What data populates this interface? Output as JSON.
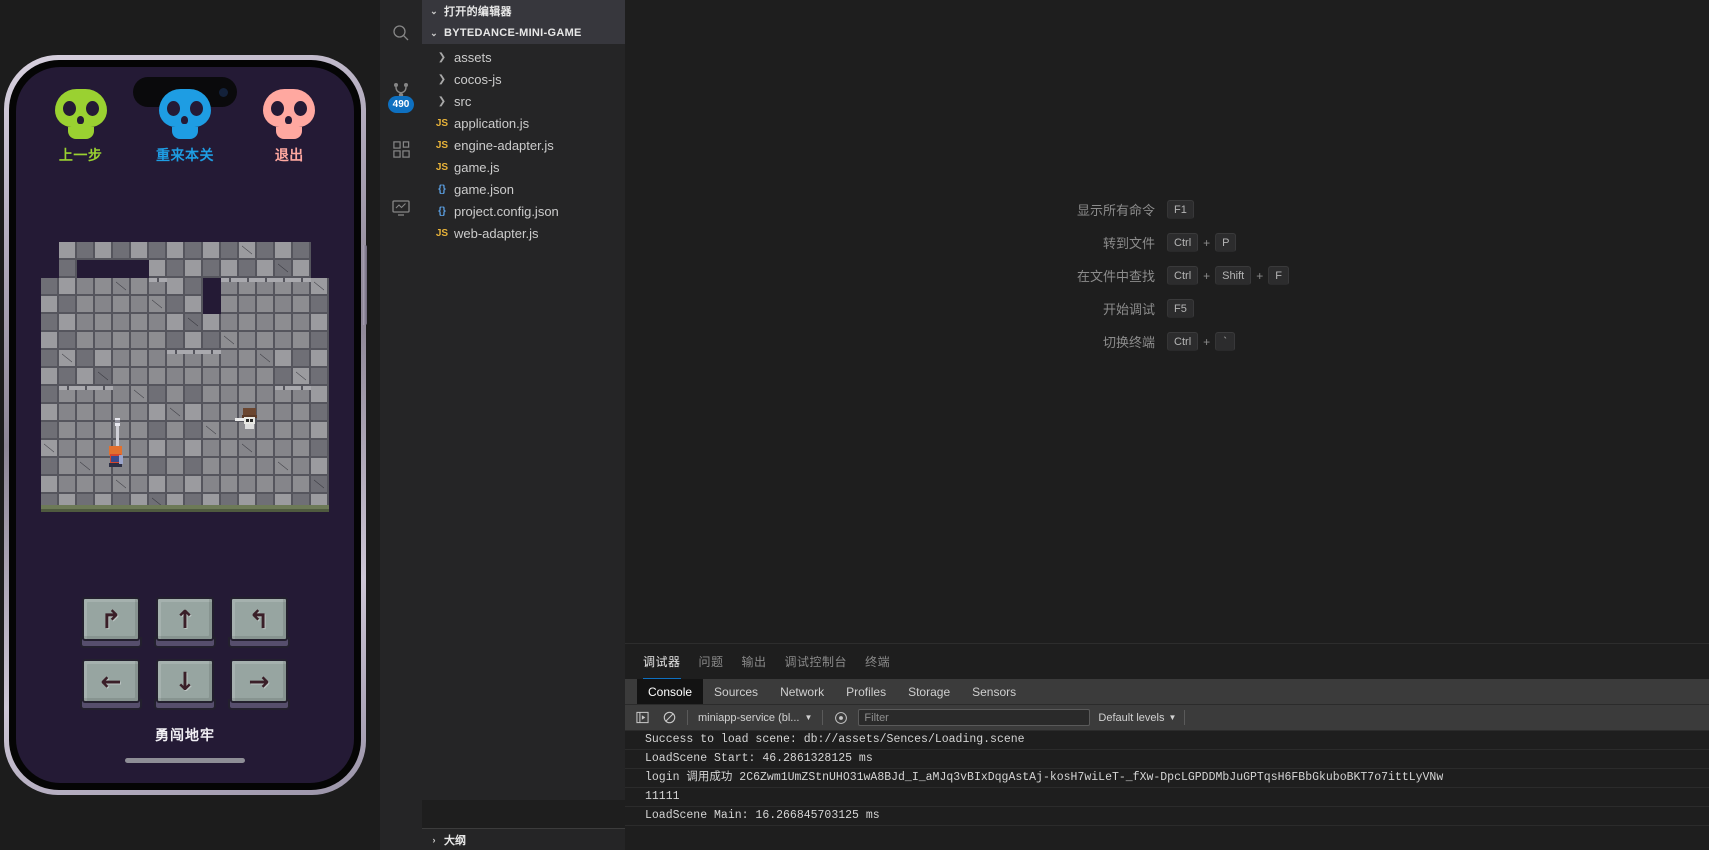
{
  "simulator": {
    "game_title": "勇闯地牢",
    "top_buttons": [
      {
        "label": "上一步",
        "color": "#9ad131",
        "icon": "skull-icon"
      },
      {
        "label": "重来本关",
        "color": "#1e9de3",
        "icon": "skull-icon"
      },
      {
        "label": "退出",
        "color": "#ffa8a0",
        "icon": "skull-icon"
      }
    ],
    "dpad_keys": [
      {
        "name": "rotate-left-key",
        "glyph": "↱"
      },
      {
        "name": "up-key",
        "glyph": "↑"
      },
      {
        "name": "rotate-right-key",
        "glyph": "↰"
      },
      {
        "name": "left-key",
        "glyph": "←"
      },
      {
        "name": "down-key",
        "glyph": "↓"
      },
      {
        "name": "right-key",
        "glyph": "→"
      }
    ],
    "screen_bg": "#241a35"
  },
  "activity_bar": {
    "items": [
      {
        "name": "search-icon",
        "badge": ""
      },
      {
        "name": "source-control-icon",
        "badge": "490"
      },
      {
        "name": "extensions-icon",
        "badge": ""
      },
      {
        "name": "remote-explorer-icon",
        "badge": ""
      }
    ],
    "badge_color": "#0e70c0"
  },
  "sidebar": {
    "open_editors_label": "打开的编辑器",
    "project_label": "BYTEDANCE-MINI-GAME",
    "outline_label": "大纲",
    "tree": [
      {
        "label": "assets",
        "type": "folder",
        "icon": "chevron-right-icon"
      },
      {
        "label": "cocos-js",
        "type": "folder",
        "icon": "chevron-right-icon"
      },
      {
        "label": "src",
        "type": "folder",
        "icon": "chevron-right-icon"
      },
      {
        "label": "application.js",
        "type": "js",
        "icon": "js-icon"
      },
      {
        "label": "engine-adapter.js",
        "type": "js",
        "icon": "js-icon"
      },
      {
        "label": "game.js",
        "type": "js",
        "icon": "js-icon"
      },
      {
        "label": "game.json",
        "type": "json",
        "icon": "json-icon"
      },
      {
        "label": "project.config.json",
        "type": "json",
        "icon": "json-icon"
      },
      {
        "label": "web-adapter.js",
        "type": "js",
        "icon": "js-icon"
      }
    ]
  },
  "editor": {
    "shortcuts": [
      {
        "label": "显示所有命令",
        "keys": [
          "F1"
        ]
      },
      {
        "label": "转到文件",
        "keys": [
          "Ctrl",
          "+",
          "P"
        ]
      },
      {
        "label": "在文件中查找",
        "keys": [
          "Ctrl",
          "+",
          "Shift",
          "+",
          "F"
        ]
      },
      {
        "label": "开始调试",
        "keys": [
          "F5"
        ]
      },
      {
        "label": "切换终端",
        "keys": [
          "Ctrl",
          "+",
          "`"
        ]
      }
    ]
  },
  "panel": {
    "tabs": [
      {
        "label": "调试器",
        "active": true
      },
      {
        "label": "问题",
        "active": false
      },
      {
        "label": "输出",
        "active": false
      },
      {
        "label": "调试控制台",
        "active": false
      },
      {
        "label": "终端",
        "active": false
      }
    ],
    "devtools_tabs": [
      {
        "label": "Console",
        "active": true
      },
      {
        "label": "Sources",
        "active": false
      },
      {
        "label": "Network",
        "active": false
      },
      {
        "label": "Profiles",
        "active": false
      },
      {
        "label": "Storage",
        "active": false
      },
      {
        "label": "Sensors",
        "active": false
      }
    ],
    "toolbar": {
      "execute_icon": "execute-snippet-icon",
      "clear_icon": "clear-console-icon",
      "context_value": "miniapp-service (bl...",
      "context_caret": "▼",
      "eye_icon": "live-expression-icon",
      "filter_placeholder": "Filter",
      "levels_label": "Default levels",
      "levels_caret": "▼"
    },
    "logs": [
      "Success to load scene: db://assets/Sences/Loading.scene",
      "LoadScene Start: 46.2861328125 ms",
      "login 调用成功 2C6Zwm1UmZStnUHO31wA8BJd_I_aMJq3vBIxDqgAstAj-kosH7wiLeT-_fXw-DpcLGPDDMbJuGPTqsH6FBbGkuboBKT7o7ittLyVNw",
      "11111",
      "LoadScene Main: 16.266845703125 ms"
    ]
  }
}
